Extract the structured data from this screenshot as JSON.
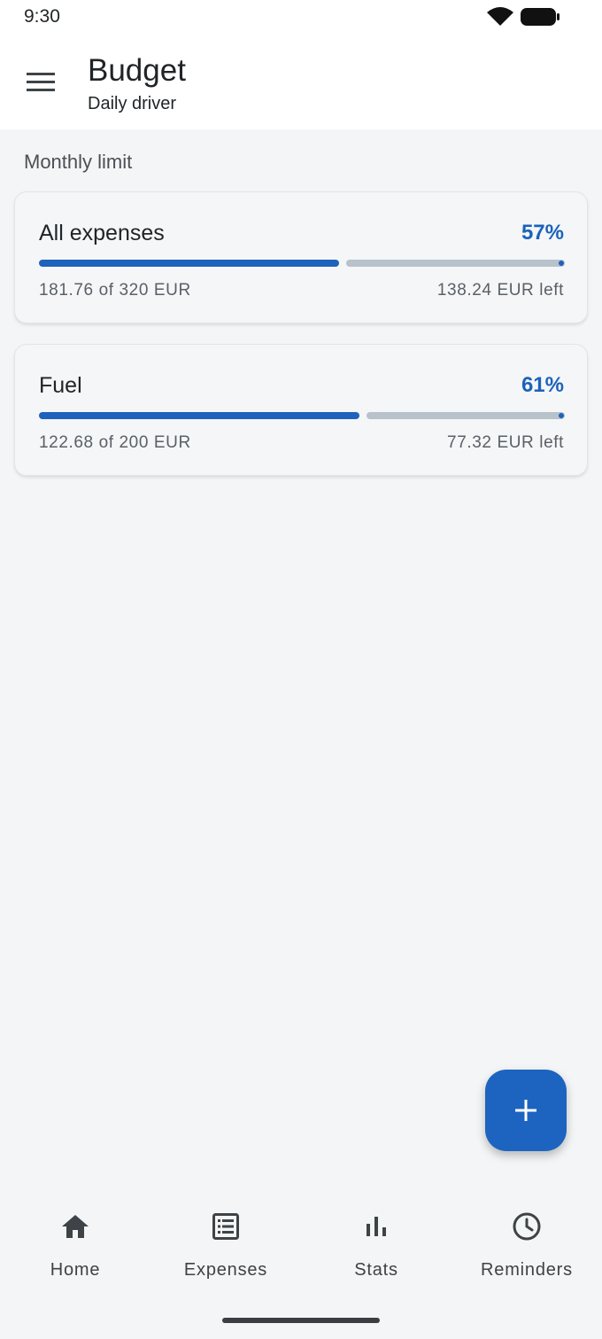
{
  "status_bar": {
    "time": "9:30"
  },
  "app_bar": {
    "title": "Budget",
    "subtitle": "Daily driver"
  },
  "section": {
    "title": "Monthly limit"
  },
  "budgets": [
    {
      "name": "All expenses",
      "percent_label": "57%",
      "progress": 0.57,
      "amount": "181.76 of 320 EUR",
      "remaining": "138.24 EUR left"
    },
    {
      "name": "Fuel",
      "percent_label": "61%",
      "progress": 0.61,
      "amount": "122.68 of 200 EUR",
      "remaining": "77.32 EUR left"
    }
  ],
  "fab": {
    "icon": "plus-icon"
  },
  "bottom_nav": [
    {
      "label": "Home",
      "icon": "home-icon"
    },
    {
      "label": "Expenses",
      "icon": "list-icon"
    },
    {
      "label": "Stats",
      "icon": "bar-chart-icon"
    },
    {
      "label": "Reminders",
      "icon": "clock-icon"
    }
  ],
  "colors": {
    "accent": "#1c62b9",
    "track": "#b8c2ca",
    "background": "#f4f5f6"
  }
}
